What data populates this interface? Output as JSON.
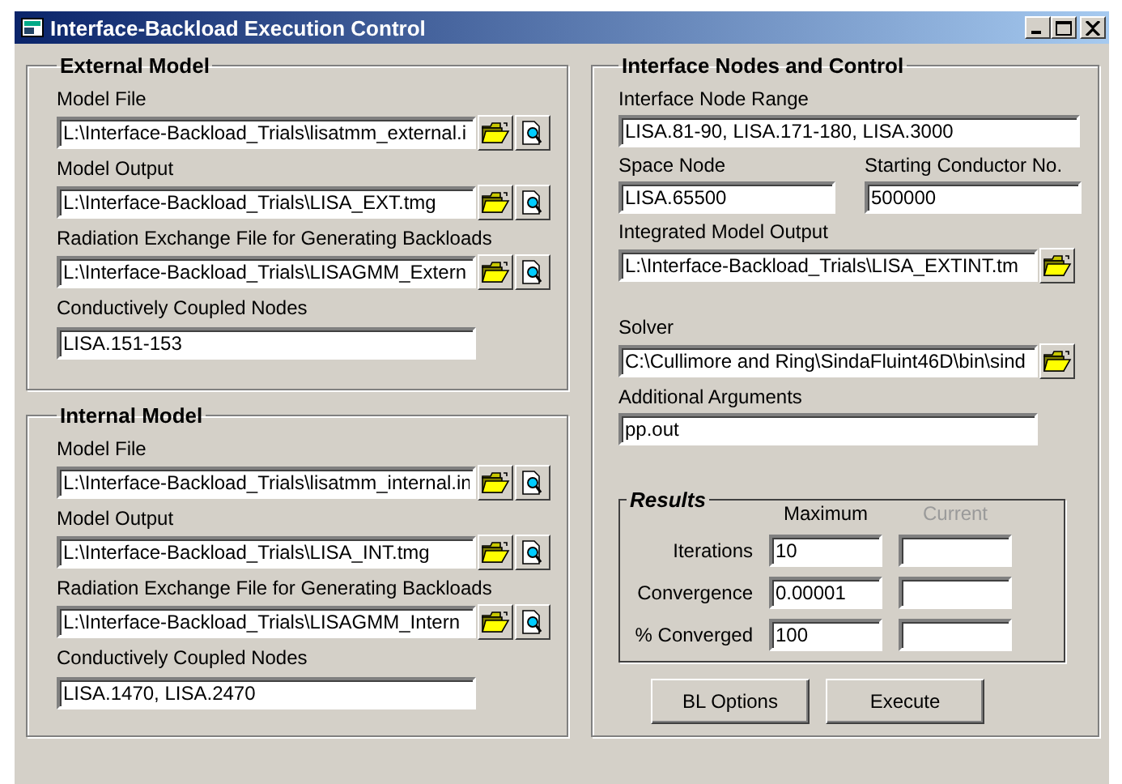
{
  "window": {
    "title": "Interface-Backload Execution Control",
    "controls": [
      {
        "kind": "minimize"
      },
      {
        "kind": "maximize"
      },
      {
        "kind": "close"
      }
    ]
  },
  "external_model": {
    "title": "External Model",
    "fields": [
      {
        "label": "Model File",
        "value": "L:\\Interface-Backload_Trials\\lisatmm_external.i",
        "actions": [
          {
            "kind": "browse"
          },
          {
            "kind": "view"
          }
        ]
      },
      {
        "label": "Model Output",
        "value": "L:\\Interface-Backload_Trials\\LISA_EXT.tmg",
        "actions": [
          {
            "kind": "browse"
          },
          {
            "kind": "view"
          }
        ]
      },
      {
        "label": "Radiation Exchange File for Generating Backloads",
        "value": "L:\\Interface-Backload_Trials\\LISAGMM_Extern",
        "actions": [
          {
            "kind": "browse"
          },
          {
            "kind": "view"
          }
        ]
      },
      {
        "label": "Conductively Coupled Nodes",
        "value": "LISA.151-153"
      }
    ]
  },
  "internal_model": {
    "title": "Internal Model",
    "fields": [
      {
        "label": "Model File",
        "value": "L:\\Interface-Backload_Trials\\lisatmm_internal.in",
        "actions": [
          {
            "kind": "browse"
          },
          {
            "kind": "view"
          }
        ]
      },
      {
        "label": "Model Output",
        "value": "L:\\Interface-Backload_Trials\\LISA_INT.tmg",
        "actions": [
          {
            "kind": "browse"
          },
          {
            "kind": "view"
          }
        ]
      },
      {
        "label": "Radiation Exchange File for Generating Backloads",
        "value": "L:\\Interface-Backload_Trials\\LISAGMM_Intern",
        "actions": [
          {
            "kind": "browse"
          },
          {
            "kind": "view"
          }
        ]
      },
      {
        "label": "Conductively Coupled Nodes",
        "value": "LISA.1470, LISA.2470"
      }
    ]
  },
  "interface": {
    "title": "Interface Nodes and Control",
    "node_range": {
      "label": "Interface Node Range",
      "value": "LISA.81-90, LISA.171-180, LISA.3000"
    },
    "space_node": {
      "label": "Space Node",
      "value": "LISA.65500"
    },
    "starting_conductor": {
      "label": "Starting Conductor No.",
      "value": "500000"
    },
    "integrated_output": {
      "label": "Integrated Model Output",
      "value": "L:\\Interface-Backload_Trials\\LISA_EXTINT.tm",
      "actions": [
        {
          "kind": "browse"
        }
      ]
    },
    "solver": {
      "label": "Solver",
      "value": "C:\\Cullimore and Ring\\SindaFluint46D\\bin\\sind",
      "actions": [
        {
          "kind": "browse"
        }
      ]
    },
    "additional_arguments": {
      "label": "Additional Arguments",
      "value": "pp.out"
    },
    "results": {
      "title": "Results",
      "columns": [
        {
          "label": "Maximum",
          "disabled": false
        },
        {
          "label": "Current",
          "disabled": true
        }
      ],
      "rows": [
        {
          "label": "Iterations",
          "maximum": "10"
        },
        {
          "label": "Convergence",
          "maximum": "0.00001"
        },
        {
          "label": "% Converged",
          "maximum": "100"
        }
      ]
    },
    "buttons": [
      "BL Options",
      "Execute"
    ]
  }
}
